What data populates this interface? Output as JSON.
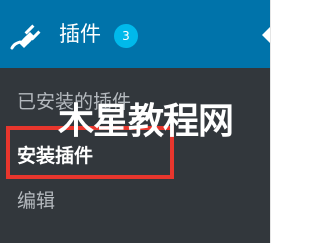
{
  "menu": {
    "title": "插件",
    "badge_count": "3",
    "icon": "plugin-icon"
  },
  "submenu": [
    {
      "label": "已安装的插件"
    },
    {
      "label": "安装插件"
    },
    {
      "label": "编辑"
    }
  ],
  "watermark": "木星教程网",
  "colors": {
    "sidebar_bg": "#32373c",
    "active_bg": "#0073aa",
    "badge": "#00b9eb",
    "highlight": "#e8362d",
    "submenu_text": "#b4b9be",
    "current_text": "#ffffff"
  }
}
